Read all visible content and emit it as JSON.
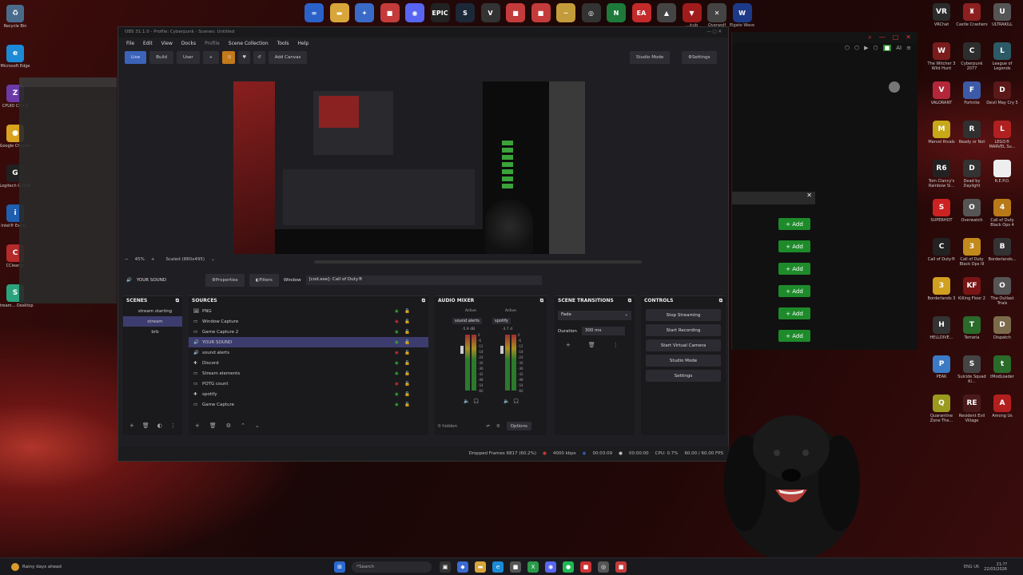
{
  "desktop_icons_left": [
    {
      "label": "Recycle Bin",
      "icon": "recycle-bin-icon",
      "color": "#4a6c8c",
      "glyph": "♻"
    },
    {
      "label": "Microsoft Edge",
      "icon": "edge-icon",
      "color": "#1c8ad6",
      "glyph": "e"
    },
    {
      "label": "CPUID CPU-Z",
      "icon": "cpuz-icon",
      "color": "#6b3aa8",
      "glyph": "Z"
    },
    {
      "label": "Google Chrome",
      "icon": "chrome-icon",
      "color": "#d9a21f",
      "glyph": "●"
    },
    {
      "label": "Logitech G HUB",
      "icon": "ghub-icon",
      "color": "#202020",
      "glyph": "G"
    },
    {
      "label": "Intel® Extre...",
      "icon": "intel-icon",
      "color": "#1f5fb0",
      "glyph": "i"
    },
    {
      "label": "CCleaner",
      "icon": "ccleaner-icon",
      "color": "#b52a2a",
      "glyph": "C"
    },
    {
      "label": "Stream... Desktop",
      "icon": "streamlabs-icon",
      "color": "#2aa37d",
      "glyph": "S"
    }
  ],
  "desktop_icons_right": [
    {
      "label": "VRChat",
      "icon": "vrchat-icon",
      "color": "#2b2b2b",
      "glyph": "VR"
    },
    {
      "label": "Castle Crashers",
      "icon": "castle-crashers-icon",
      "color": "#8c1f1f",
      "glyph": "♜"
    },
    {
      "label": "ULTRAKILL",
      "icon": "ultrakill-icon",
      "color": "#555",
      "glyph": "U"
    },
    {
      "label": "The Witcher 3 Wild Hunt",
      "icon": "witcher-icon",
      "color": "#7a1c1c",
      "glyph": "W"
    },
    {
      "label": "Cyberpunk 2077",
      "icon": "cyberpunk-icon",
      "color": "#2d2d2d",
      "glyph": "C"
    },
    {
      "label": "League of Legends",
      "icon": "league-icon",
      "color": "#2c5a66",
      "glyph": "L"
    },
    {
      "label": "VALORANT",
      "icon": "valorant-icon",
      "color": "#b3273a",
      "glyph": "V"
    },
    {
      "label": "Fortnite",
      "icon": "fortnite-icon",
      "color": "#3c5aa8",
      "glyph": "F"
    },
    {
      "label": "Devil May Cry 5",
      "icon": "dmc-icon",
      "color": "#5a1818",
      "glyph": "D"
    },
    {
      "label": "Marvel Rivals",
      "icon": "marvel-rivals-icon",
      "color": "#c6a818",
      "glyph": "M"
    },
    {
      "label": "Ready or Not",
      "icon": "ready-or-not-icon",
      "color": "#303030",
      "glyph": "R"
    },
    {
      "label": "LEGO® MARVEL Su...",
      "icon": "lego-marvel-icon",
      "color": "#b02020",
      "glyph": "L"
    },
    {
      "label": "Tom Clancy's Rainbow Si...",
      "icon": "rainbow-six-icon",
      "color": "#222",
      "glyph": "R6"
    },
    {
      "label": "Dead by Daylight",
      "icon": "dbd-icon",
      "color": "#333",
      "glyph": "D"
    },
    {
      "label": "R.E.P.O.",
      "icon": "repo-icon",
      "color": "#eee",
      "glyph": ""
    },
    {
      "label": "SUPERHOT",
      "icon": "superhot-icon",
      "color": "#c22",
      "glyph": "S"
    },
    {
      "label": "Overwatch",
      "icon": "overwatch-icon",
      "color": "#555",
      "glyph": "O"
    },
    {
      "label": "Call of Duty Black Ops 4",
      "icon": "bo4-icon",
      "color": "#b87a18",
      "glyph": "4"
    },
    {
      "label": "Call of Duty®",
      "icon": "cod-icon",
      "color": "#222",
      "glyph": "C"
    },
    {
      "label": "Call of Duty Black Ops III",
      "icon": "bo3-icon",
      "color": "#c28a1c",
      "glyph": "3"
    },
    {
      "label": "Borderlands...",
      "icon": "borderlands-icon",
      "color": "#333",
      "glyph": "B"
    },
    {
      "label": "Borderlands 3",
      "icon": "borderlands3-icon",
      "color": "#d0a020",
      "glyph": "3"
    },
    {
      "label": "Killing Floor 2",
      "icon": "killing-floor-icon",
      "color": "#7a1515",
      "glyph": "KF"
    },
    {
      "label": "The Outlast Trials",
      "icon": "outlast-icon",
      "color": "#555",
      "glyph": "O"
    },
    {
      "label": "HELLDIVE...",
      "icon": "helldivers-icon",
      "color": "#333",
      "glyph": "H"
    },
    {
      "label": "Terraria",
      "icon": "terraria-icon",
      "color": "#2a6a2a",
      "glyph": "T"
    },
    {
      "label": "Dispatch",
      "icon": "dispatch-icon",
      "color": "#7b6b4a",
      "glyph": "D"
    },
    {
      "label": "PEAK",
      "icon": "peak-icon",
      "color": "#3b7ac4",
      "glyph": "P"
    },
    {
      "label": "Suicide Squad Ki...",
      "icon": "suicide-squad-icon",
      "color": "#444",
      "glyph": "S"
    },
    {
      "label": "tModLoader",
      "icon": "tmodloader-icon",
      "color": "#2a6a2a",
      "glyph": "t"
    },
    {
      "label": "Quarantine Zone The...",
      "icon": "quarantine-icon",
      "color": "#9a9a1f",
      "glyph": "Q"
    },
    {
      "label": "Resident Evil Village",
      "icon": "re-village-icon",
      "color": "#4a1a1a",
      "glyph": "RE"
    },
    {
      "label": "Among Us",
      "icon": "among-us-icon",
      "color": "#b21f1f",
      "glyph": "A"
    }
  ],
  "top_icons": [
    {
      "icon": "meta-icon",
      "color": "#2a62c9",
      "glyph": "∞",
      "label": ""
    },
    {
      "icon": "folder-icon",
      "color": "#d8a53a",
      "glyph": "▬",
      "label": ""
    },
    {
      "icon": "app-icon",
      "color": "#3a6ac8",
      "glyph": "✦",
      "label": ""
    },
    {
      "icon": "app-red-icon",
      "color": "#c43b3b",
      "glyph": "■",
      "label": ""
    },
    {
      "icon": "discord-icon",
      "color": "#5865f2",
      "glyph": "◉",
      "label": ""
    },
    {
      "icon": "epic-games-icon",
      "color": "#222",
      "glyph": "EPIC",
      "label": ""
    },
    {
      "icon": "steam-icon",
      "color": "#1b2838",
      "glyph": "S",
      "label": ""
    },
    {
      "icon": "vpn-icon",
      "color": "#333",
      "glyph": "V",
      "label": ""
    },
    {
      "icon": "app2-icon",
      "color": "#c43b3b",
      "glyph": "■",
      "label": ""
    },
    {
      "icon": "app3-icon",
      "color": "#c43b3b",
      "glyph": "■",
      "label": ""
    },
    {
      "icon": "app4-icon",
      "color": "#c49b3b",
      "glyph": "~",
      "label": ""
    },
    {
      "icon": "obs-icon",
      "color": "#333",
      "glyph": "◎",
      "label": ""
    },
    {
      "icon": "nvidia-icon",
      "color": "#1e7a3a",
      "glyph": "N",
      "label": ""
    },
    {
      "icon": "ea-icon",
      "color": "#c42a2a",
      "glyph": "EA",
      "label": ""
    },
    {
      "icon": "app5-icon",
      "color": "#444",
      "glyph": "▲",
      "label": ""
    },
    {
      "icon": "app6-icon",
      "color": "#a01c1c",
      "glyph": "▼",
      "label": "...icub"
    },
    {
      "icon": "overwolf-icon",
      "color": "#444",
      "glyph": "✕",
      "label": "Overwolf"
    },
    {
      "icon": "elgato-wave-icon",
      "color": "#1d3a88",
      "glyph": "W",
      "label": "Elgato Wave"
    }
  ],
  "obs": {
    "title": "OBS 31.1.0 - Profile: Cyberpunk - Scenes: Untitled",
    "menu": [
      "File",
      "Edit",
      "View",
      "Docks",
      "Profile",
      "Scene Collection",
      "Tools",
      "Help"
    ],
    "toolbar": {
      "live": "Live",
      "build": "Build",
      "user": "User",
      "plus": "+",
      "add_canvas": "Add Canvas",
      "studio_mode": "Studio Mode",
      "settings": "Settings"
    },
    "zoom": {
      "minus": "−",
      "value": "45%",
      "plus": "+",
      "scale": "Scaled (880x495)"
    },
    "source_bar": {
      "name": "YOUR SOUND",
      "properties": "Properties",
      "filters": "Filters",
      "window_label": "Window",
      "window_value": "[cod.exe]: Call of Duty®"
    },
    "scenes": {
      "title": "SCENES",
      "items": [
        "stream starting",
        "stream",
        "brb"
      ],
      "selected": 1
    },
    "sources": {
      "title": "SOURCES",
      "items": [
        "PNG",
        "Window Capture",
        "Game Capture 2",
        "YOUR SOUND",
        "sound alerts",
        "Discord",
        "Stream elements",
        "POTG count",
        "spotify",
        "Game Capture",
        "Display Capture"
      ],
      "selected": 3
    },
    "mixer": {
      "title": "AUDIO MIXER",
      "channels": [
        {
          "name": "sound alerts",
          "status": "Active",
          "db": "-5.9 dB"
        },
        {
          "name": "spotify",
          "status": "Active",
          "db": "-3.7 d"
        }
      ],
      "scale": [
        "0",
        "-6",
        "-12",
        "-18",
        "-24",
        "-30",
        "-36",
        "-42",
        "-48",
        "-54",
        "-60"
      ],
      "hidden": "0 hidden",
      "options": "Options"
    },
    "transitions": {
      "title": "SCENE TRANSITIONS",
      "type": "Fade",
      "duration_label": "Duration",
      "duration": "300 ms"
    },
    "controls": {
      "title": "CONTROLS",
      "buttons": [
        "Stop Streaming",
        "Start Recording",
        "Start Virtual Camera",
        "Studio Mode",
        "Settings"
      ]
    },
    "status": {
      "dropped": "Dropped Frames 6817 (60.2%)",
      "bitrate": "4000 kbps",
      "time": "00:03:09",
      "rec": "00:00:00",
      "cpu": "CPU: 0.7%",
      "fps": "60.00 / 60.00 FPS"
    }
  },
  "bgwin": {
    "add_label": "Add",
    "count": 6
  },
  "taskbar": {
    "weather": "Rainy days ahead",
    "search": "Search",
    "time": "21:??",
    "date": "22/03/2026",
    "lang": "ENG UK"
  }
}
